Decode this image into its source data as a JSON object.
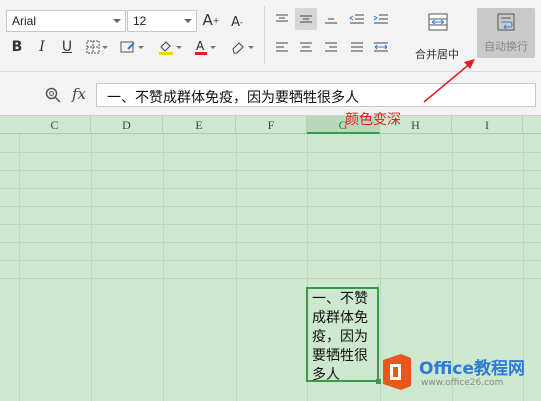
{
  "font": {
    "name": "Arial",
    "size": "12"
  },
  "ribbon": {
    "merge_center_label": "合并居中",
    "wrap_text_label": "自动换行"
  },
  "formula_bar": {
    "fx_label": "fx",
    "content": "一、不赞成群体免疫，因为要牺牲很多人"
  },
  "columns": [
    "C",
    "D",
    "E",
    "F",
    "G",
    "H",
    "I"
  ],
  "selected_cell": {
    "text": "一、不赞成群体免疫，因为要牺牲很多人"
  },
  "annotation": "颜色变深",
  "watermark": {
    "brand": "Office教程网",
    "url": "www.office26.com"
  },
  "colors": {
    "grid_bg": "#cce8cf",
    "selection": "#3a9a47",
    "annotation": "#e02020"
  }
}
